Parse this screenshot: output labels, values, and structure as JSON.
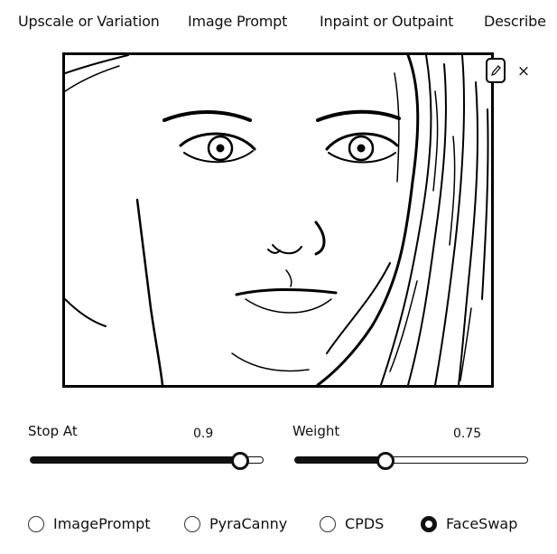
{
  "tabs": [
    {
      "label": "Upscale or Variation"
    },
    {
      "label": "Image Prompt"
    },
    {
      "label": "Inpaint or Outpaint"
    },
    {
      "label": "Describe"
    }
  ],
  "image": {
    "icons": {
      "edit": "pencil-icon",
      "close": "close-icon"
    },
    "close_glyph": "×"
  },
  "sliders": {
    "stop_at": {
      "label": "Stop At",
      "value": "0.9",
      "fraction": 0.9
    },
    "weight": {
      "label": "Weight",
      "value": "0.75",
      "fraction": 0.385
    }
  },
  "radios": [
    {
      "label": "ImagePrompt",
      "checked": false
    },
    {
      "label": "PyraCanny",
      "checked": false
    },
    {
      "label": "CPDS",
      "checked": false
    },
    {
      "label": "FaceSwap",
      "checked": true
    }
  ],
  "colors": {
    "ink": "#111111",
    "background": "#ffffff"
  }
}
